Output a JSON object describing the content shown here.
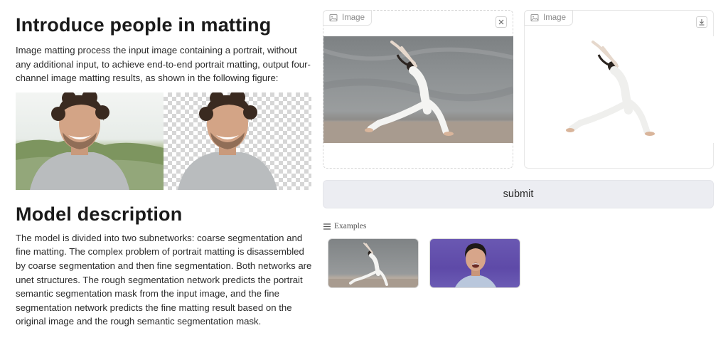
{
  "intro": {
    "title": "Introduce people in matting",
    "text": "Image matting process the input image containing a portrait, without any additional input, to achieve end-to-end portrait matting, output four-channel image matting results, as shown in the following figure:"
  },
  "model": {
    "title": "Model description",
    "text": "The model is divided into two subnetworks: coarse segmentation and fine matting. The complex problem of portrait matting is disassembled by coarse segmentation and then fine segmentation. Both networks are unet structures. The rough segmentation network predicts the portrait semantic segmentation mask from the input image, and the fine segmentation network predicts the fine matting result based on the original image and the rough semantic segmentation mask."
  },
  "input_panel": {
    "label": "Image",
    "icon": "image-icon",
    "action_icon": "close-icon"
  },
  "output_panel": {
    "label": "Image",
    "icon": "image-icon",
    "action_icon": "download-icon"
  },
  "submit": {
    "label": "submit"
  },
  "examples": {
    "label": "Examples",
    "icon": "list-icon"
  }
}
